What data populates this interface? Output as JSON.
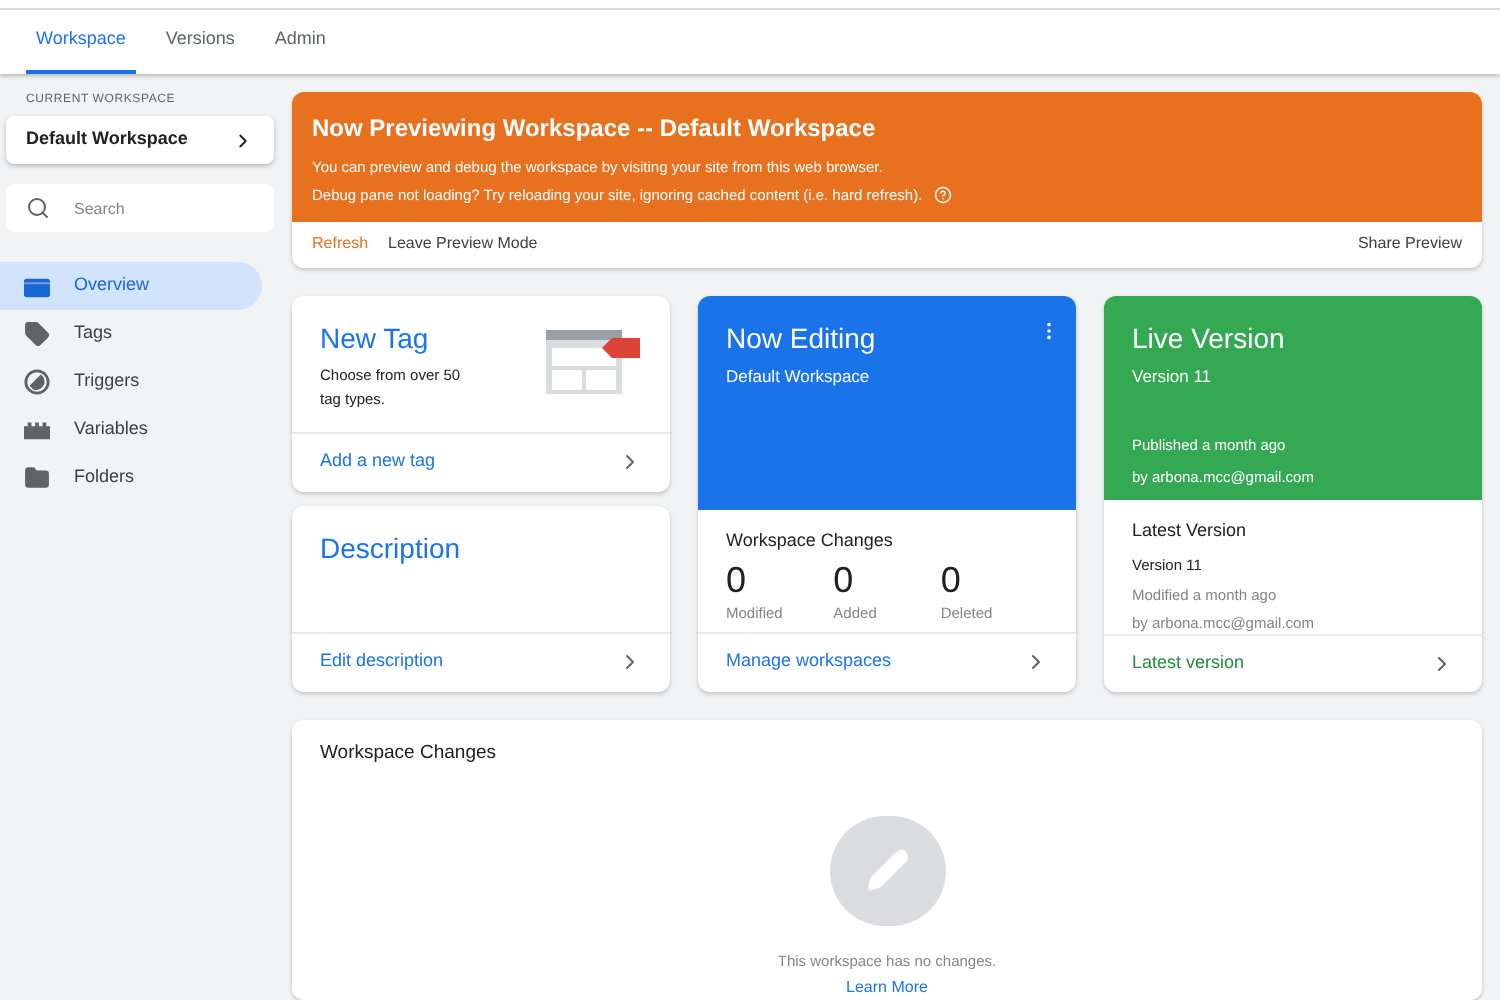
{
  "tabs": [
    {
      "label": "Workspace",
      "selected": true
    },
    {
      "label": "Versions",
      "selected": false
    },
    {
      "label": "Admin",
      "selected": false
    }
  ],
  "sidebar": {
    "current_workspace_label": "CURRENT WORKSPACE",
    "workspace": "Default Workspace",
    "search": {
      "placeholder": "Search"
    },
    "items": [
      {
        "label": "Overview",
        "kind": "overview",
        "selected": true
      },
      {
        "label": "Tags",
        "kind": "tags",
        "selected": false
      },
      {
        "label": "Triggers",
        "kind": "triggers",
        "selected": false
      },
      {
        "label": "Variables",
        "kind": "variables",
        "selected": false
      },
      {
        "label": "Folders",
        "kind": "folders",
        "selected": false
      }
    ]
  },
  "preview_banner": {
    "title": "Now Previewing Workspace -- Default Workspace",
    "lines": [
      "You can preview and debug the workspace by visiting your site from this web browser.",
      "Debug pane not loading? Try reloading your site, ignoring cached content (i.e. hard refresh)."
    ],
    "actions": [
      "Refresh",
      "Leave Preview Mode"
    ],
    "share": "Share Preview"
  },
  "new_tag": {
    "title": "New Tag",
    "text": "Choose from over 50 tag types.",
    "link": "Add a new tag"
  },
  "description": {
    "title": "Description",
    "link": "Edit description"
  },
  "now_editing": {
    "title": "Now Editing",
    "subtitle": "Default Workspace",
    "changes_title": "Workspace Changes",
    "stats": [
      {
        "value": "0",
        "label": "Modified"
      },
      {
        "value": "0",
        "label": "Added"
      },
      {
        "value": "0",
        "label": "Deleted"
      }
    ],
    "link": "Manage workspaces"
  },
  "live_version": {
    "title": "Live Version",
    "subtitle": "Version 11",
    "published": "Published a month ago",
    "by": "by arbona.mcc@gmail.com",
    "latest_title": "Latest Version",
    "latest_version": "Version 11",
    "modified": "Modified a month ago",
    "latest_by": "by arbona.mcc@gmail.com",
    "link": "Latest version"
  },
  "workspace_changes": {
    "title": "Workspace Changes",
    "empty_text": "This workspace has no changes.",
    "link": "Learn More"
  }
}
